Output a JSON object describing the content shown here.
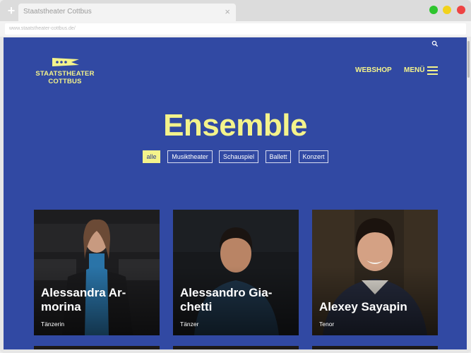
{
  "browser": {
    "tab_title": "Staatstheater Cottbus",
    "tab_close": "×",
    "new_tab": "+",
    "url": "www.staatstheater-cottbus.de/"
  },
  "site": {
    "logo_line1": "STAATSTHEATER",
    "logo_line2": "COTTBUS",
    "webshop_label": "WEBSHOP",
    "menu_label": "MENÜ",
    "accent_color": "#f4f38b",
    "background_color": "#3149a3"
  },
  "page": {
    "title": "Ensemble",
    "filters": [
      {
        "label": "alle",
        "active": true
      },
      {
        "label": "Musiktheater",
        "active": false
      },
      {
        "label": "Schauspiel",
        "active": false
      },
      {
        "label": "Ballett",
        "active": false
      },
      {
        "label": "Konzert",
        "active": false
      }
    ]
  },
  "ensemble": [
    {
      "name": "Alessandra Ar-\nmorina",
      "role": "Tänzerin"
    },
    {
      "name": "Alessandro Gia-\nchetti",
      "role": "Tänzer"
    },
    {
      "name": "Alexey Sayapin",
      "role": "Tenor"
    }
  ]
}
